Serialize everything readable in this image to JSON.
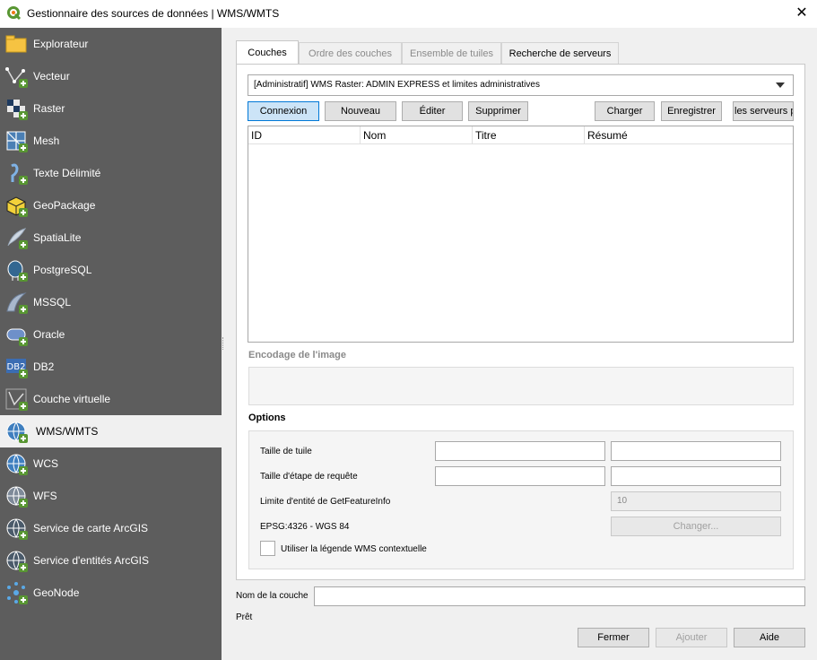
{
  "window": {
    "title": "Gestionnaire des sources de données | WMS/WMTS",
    "close_glyph": "✕"
  },
  "sidebar": {
    "items": [
      {
        "label": "Explorateur",
        "icon": "folder-icon"
      },
      {
        "label": "Vecteur",
        "icon": "vector-icon"
      },
      {
        "label": "Raster",
        "icon": "raster-icon"
      },
      {
        "label": "Mesh",
        "icon": "mesh-icon"
      },
      {
        "label": "Texte Délimité",
        "icon": "delimited-text-icon"
      },
      {
        "label": "GeoPackage",
        "icon": "geopackage-icon"
      },
      {
        "label": "SpatiaLite",
        "icon": "spatialite-icon"
      },
      {
        "label": "PostgreSQL",
        "icon": "postgresql-icon"
      },
      {
        "label": "MSSQL",
        "icon": "mssql-icon"
      },
      {
        "label": "Oracle",
        "icon": "oracle-icon"
      },
      {
        "label": "DB2",
        "icon": "db2-icon"
      },
      {
        "label": "Couche virtuelle",
        "icon": "virtual-layer-icon"
      },
      {
        "label": "WMS/WMTS",
        "icon": "wms-icon",
        "active": true
      },
      {
        "label": "WCS",
        "icon": "wcs-icon"
      },
      {
        "label": "WFS",
        "icon": "wfs-icon"
      },
      {
        "label": "Service de carte ArcGIS",
        "icon": "arcgis-map-icon"
      },
      {
        "label": "Service d'entités ArcGIS",
        "icon": "arcgis-feature-icon"
      },
      {
        "label": "GeoNode",
        "icon": "geonode-icon"
      }
    ]
  },
  "tabs": [
    {
      "label": "Couches",
      "active": true
    },
    {
      "label": "Ordre des couches"
    },
    {
      "label": "Ensemble de tuiles"
    },
    {
      "label": "Recherche de serveurs"
    }
  ],
  "connection": {
    "selected": "[Administratif] WMS Raster: ADMIN EXPRESS et limites administratives"
  },
  "buttons": {
    "connect": "Connexion",
    "new": "Nouveau",
    "edit": "Éditer",
    "delete": "Supprimer",
    "load": "Charger",
    "save": "Enregistrer",
    "servers": "les serveurs pa"
  },
  "table": {
    "columns": [
      "ID",
      "Nom",
      "Titre",
      "Résumé"
    ],
    "rows": []
  },
  "encoding": {
    "label": "Encodage de l'image"
  },
  "options": {
    "label": "Options",
    "tile_size_label": "Taille de tuile",
    "request_step_label": "Taille d'étape de requête",
    "feature_limit_label": "Limite d'entité de GetFeatureInfo",
    "feature_limit_value": "10",
    "crs_label": "EPSG:4326 - WGS 84",
    "change_button": "Changer...",
    "contextual_legend_label": "Utiliser la légende WMS contextuelle"
  },
  "footer": {
    "layer_name_label": "Nom de la couche",
    "layer_name_value": "",
    "status": "Prêt",
    "close_button": "Fermer",
    "add_button": "Ajouter",
    "help_button": "Aide"
  },
  "colors": {
    "sidebar_bg": "#5d5d5d",
    "focus_button_bg": "#cce4f7",
    "focus_button_border": "#0078d7",
    "qgis_green": "#589632"
  }
}
